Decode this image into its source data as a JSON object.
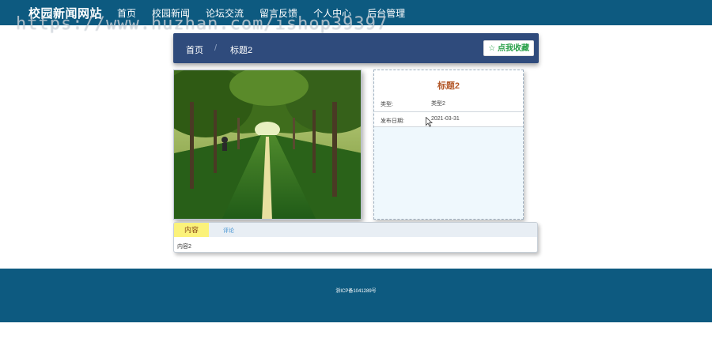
{
  "header": {
    "brand": "校园新闻网站",
    "nav": [
      "首页",
      "校园新闻",
      "论坛交流",
      "留言反馈",
      "个人中心",
      "后台管理"
    ],
    "watermark": "https://www.huzhan.com/ishop39397"
  },
  "breadcrumb": {
    "home": "首页",
    "separator": "/",
    "current": "标题2",
    "favorite_label": "☆ 点我收藏"
  },
  "photo": {
    "icon": "tree-lined-road-photo"
  },
  "detail": {
    "title": "标题2",
    "fields": [
      {
        "label": "类型:",
        "value": "类型2"
      },
      {
        "label": "发布日期:",
        "value": "2021-03-31"
      }
    ]
  },
  "tabs": {
    "active": "内容",
    "other": "评论",
    "content": "内容2"
  },
  "footer": {
    "icp": "浙ICP备1041289号"
  },
  "colors": {
    "header": "#0d5a80",
    "breadcrumb_bar": "#2f4b7c",
    "tab_active": "#fbf27a",
    "title": "#b45a2c"
  }
}
